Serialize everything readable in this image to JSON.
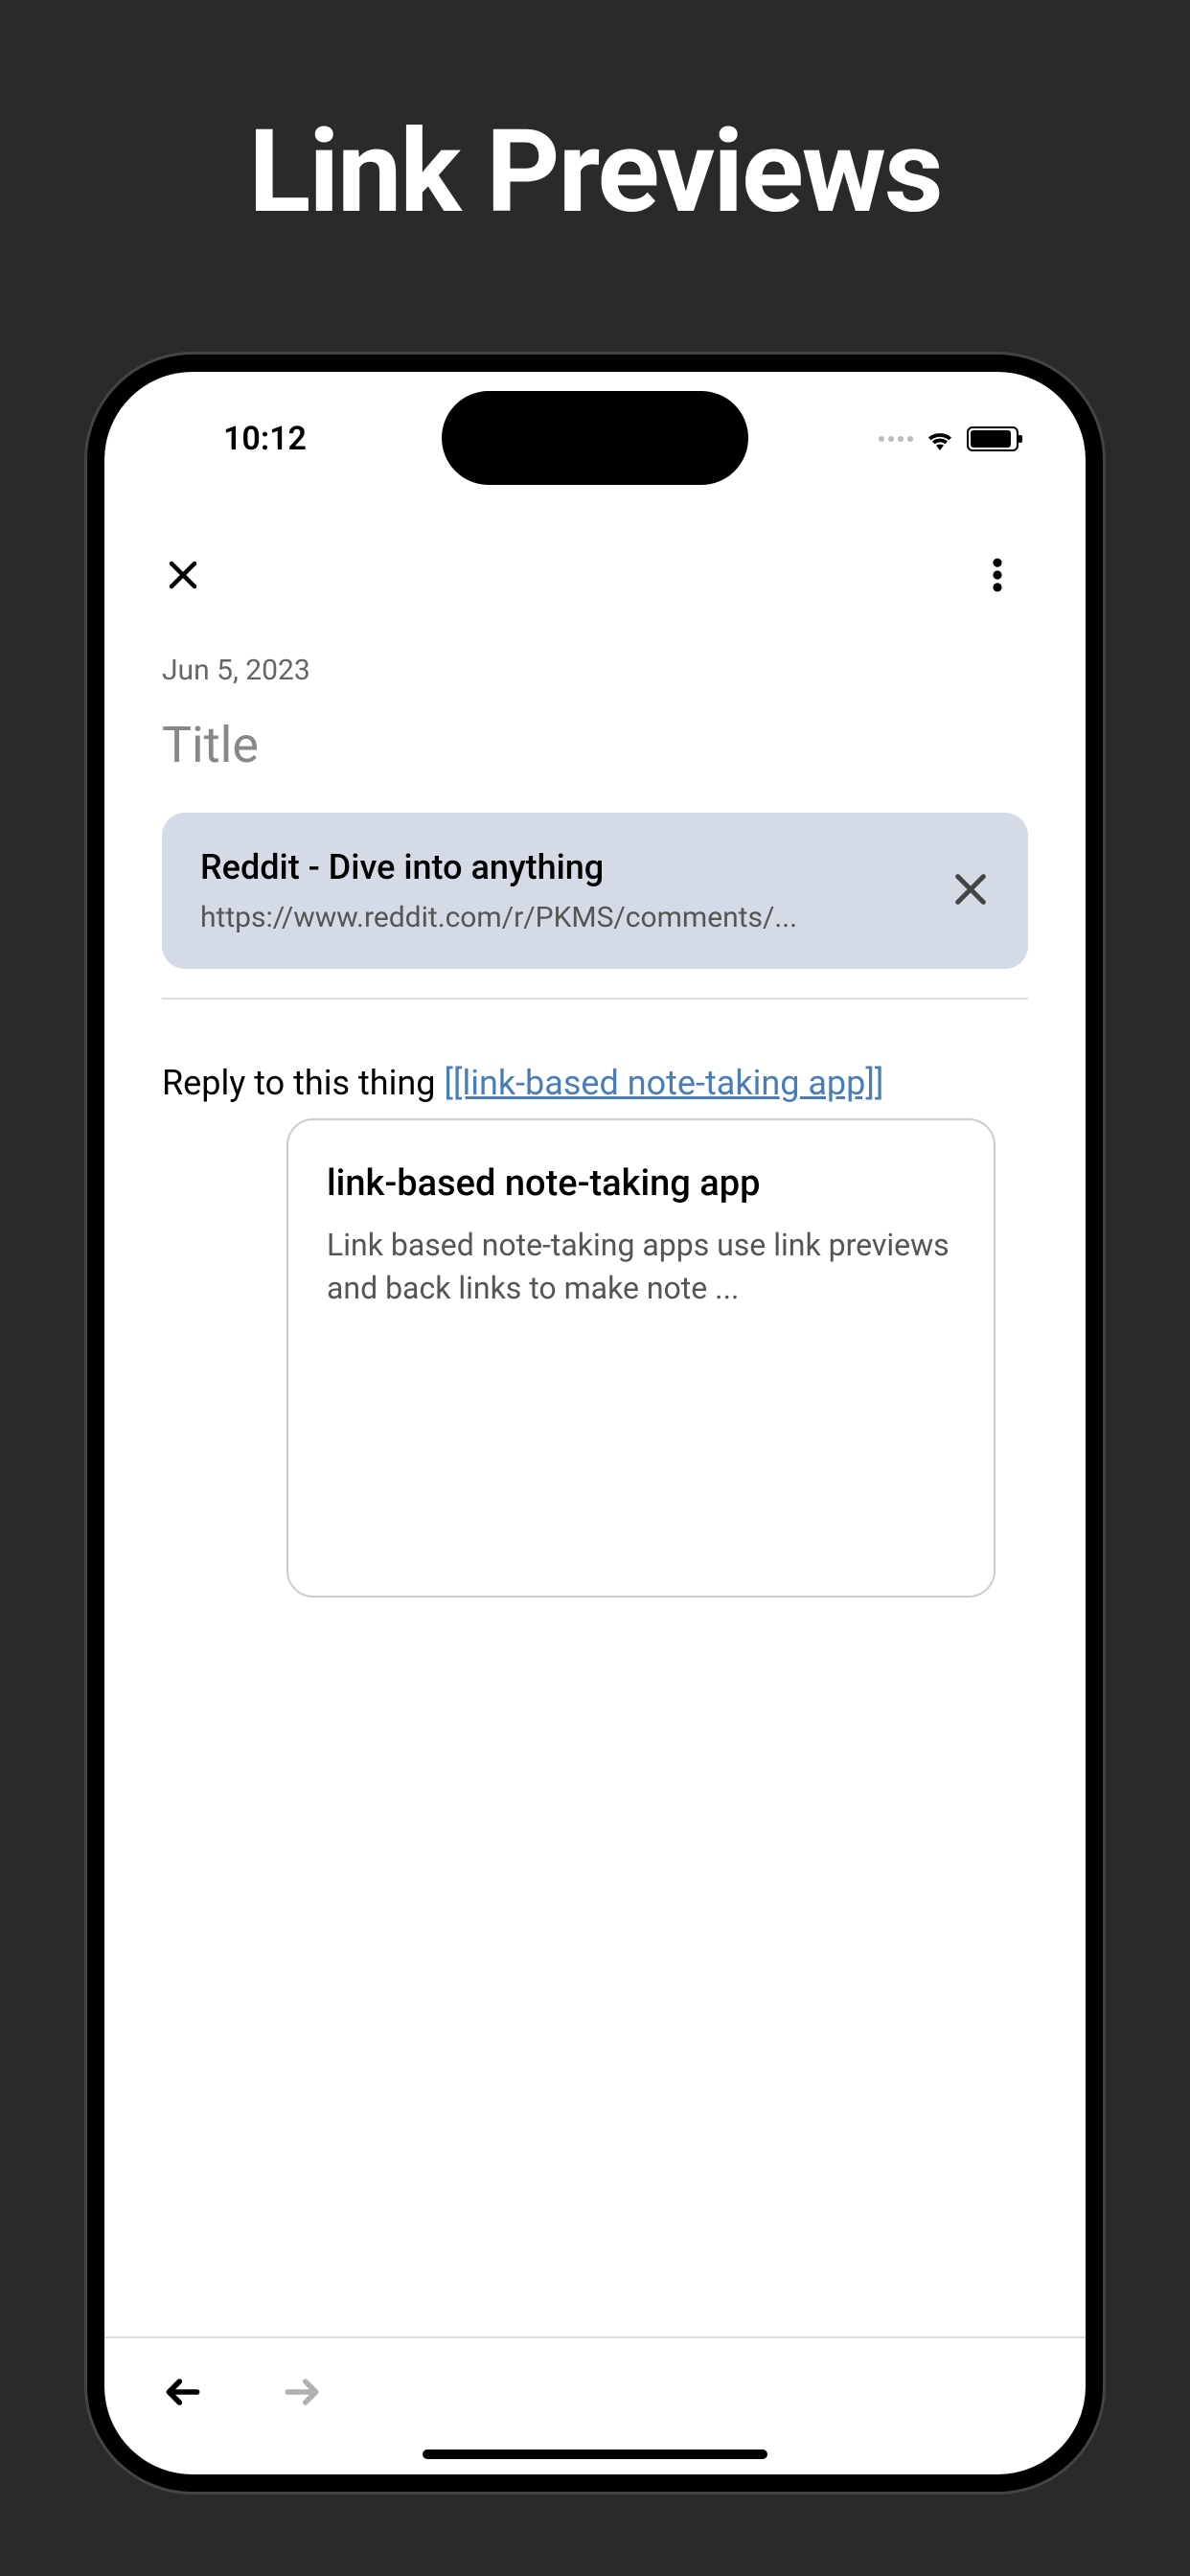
{
  "feature_title": "Link Previews",
  "status": {
    "time": "10:12"
  },
  "note": {
    "date": "Jun 5, 2023",
    "title_placeholder": "Title",
    "body_prefix": "Reply to this thing ",
    "wiki_link_text": "[[link-based note-taking app]]"
  },
  "link_preview": {
    "title": "Reddit - Dive into anything",
    "url": "https://www.reddit.com/r/PKMS/comments/..."
  },
  "popover": {
    "title": "link-based note-taking app",
    "text": "Link based note-taking apps use link previews and back links to make note ..."
  }
}
